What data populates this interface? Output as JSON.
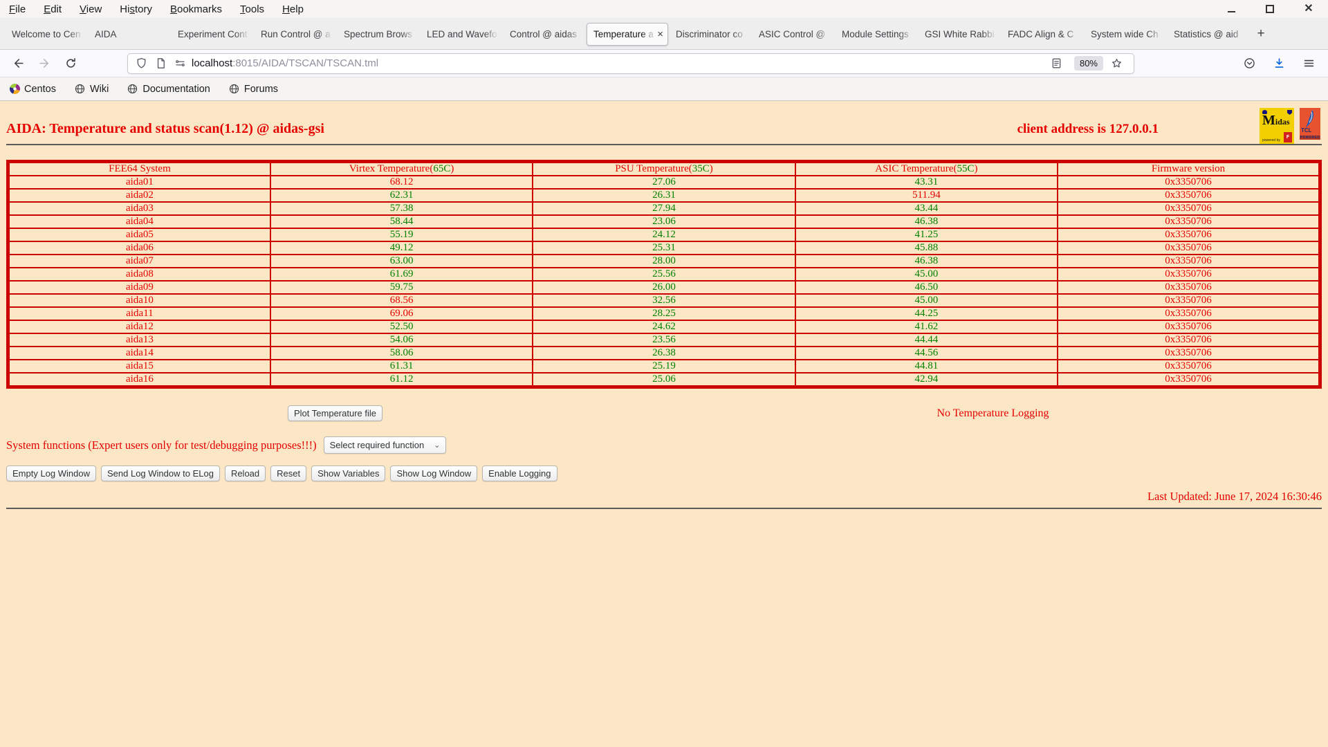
{
  "menubar": {
    "items": [
      {
        "key": "file",
        "pre": "",
        "u": "F",
        "post": "ile"
      },
      {
        "key": "edit",
        "pre": "",
        "u": "E",
        "post": "dit"
      },
      {
        "key": "view",
        "pre": "",
        "u": "V",
        "post": "iew"
      },
      {
        "key": "history",
        "pre": "Hi",
        "u": "s",
        "post": "tory"
      },
      {
        "key": "bookmarks",
        "pre": "",
        "u": "B",
        "post": "ookmarks"
      },
      {
        "key": "tools",
        "pre": "",
        "u": "T",
        "post": "ools"
      },
      {
        "key": "help",
        "pre": "",
        "u": "H",
        "post": "elp"
      }
    ]
  },
  "tabbar": {
    "tabs": [
      {
        "label": "Welcome to Cen",
        "active": false
      },
      {
        "label": "AIDA",
        "active": false
      },
      {
        "label": "Experiment Cont",
        "active": false
      },
      {
        "label": "Run Control @ a",
        "active": false
      },
      {
        "label": "Spectrum Brows",
        "active": false
      },
      {
        "label": "LED and Wavefo",
        "active": false
      },
      {
        "label": "Control @ aidas",
        "active": false
      },
      {
        "label": "Temperature a",
        "active": true
      },
      {
        "label": "Discriminator co",
        "active": false
      },
      {
        "label": "ASIC Control @",
        "active": false
      },
      {
        "label": "Module Settings",
        "active": false
      },
      {
        "label": "GSI White Rabbi",
        "active": false
      },
      {
        "label": "FADC Align & C",
        "active": false
      },
      {
        "label": "System wide Ch",
        "active": false
      },
      {
        "label": "Statistics @ aid",
        "active": false
      }
    ],
    "close_glyph": "×",
    "new_tab_glyph": "+"
  },
  "navbar": {
    "url": {
      "host": "localhost",
      "rest": ":8015/AIDA/TSCAN/TSCAN.tml"
    },
    "zoom": "80%"
  },
  "bookmarks": [
    {
      "label": "Centos",
      "icon": "centos"
    },
    {
      "label": "Wiki",
      "icon": "globe"
    },
    {
      "label": "Documentation",
      "icon": "globe"
    },
    {
      "label": "Forums",
      "icon": "globe"
    }
  ],
  "page": {
    "title": "AIDA: Temperature and status scan(1.12) @ aidas-gsi",
    "client_address": "client address is 127.0.0.1",
    "logos": {
      "midas_m": "M",
      "midas_rest": "idas",
      "midas_sub": "powered by",
      "midas_box": "F",
      "tcl_text": "TCL",
      "tcl_sub": "POWERED"
    },
    "table": {
      "headers": [
        {
          "pre": "FEE64 System",
          "limit": "",
          "post": ""
        },
        {
          "pre": "Virtex Temperature(",
          "limit": "65C",
          "post": ")"
        },
        {
          "pre": "PSU Temperature(",
          "limit": "35C",
          "post": ")"
        },
        {
          "pre": "ASIC Temperature(",
          "limit": "55C",
          "post": ")"
        },
        {
          "pre": "Firmware version",
          "limit": "",
          "post": ""
        }
      ],
      "rows": [
        {
          "system": "aida01",
          "virtex": "68.12",
          "virtex_alarm": true,
          "psu": "27.06",
          "psu_alarm": false,
          "asic": "43.31",
          "asic_alarm": false,
          "firmware": "0x3350706"
        },
        {
          "system": "aida02",
          "virtex": "62.31",
          "virtex_alarm": false,
          "psu": "26.31",
          "psu_alarm": false,
          "asic": "511.94",
          "asic_alarm": true,
          "firmware": "0x3350706"
        },
        {
          "system": "aida03",
          "virtex": "57.38",
          "virtex_alarm": false,
          "psu": "27.94",
          "psu_alarm": false,
          "asic": "43.44",
          "asic_alarm": false,
          "firmware": "0x3350706"
        },
        {
          "system": "aida04",
          "virtex": "58.44",
          "virtex_alarm": false,
          "psu": "23.06",
          "psu_alarm": false,
          "asic": "46.38",
          "asic_alarm": false,
          "firmware": "0x3350706"
        },
        {
          "system": "aida05",
          "virtex": "55.19",
          "virtex_alarm": false,
          "psu": "24.12",
          "psu_alarm": false,
          "asic": "41.25",
          "asic_alarm": false,
          "firmware": "0x3350706"
        },
        {
          "system": "aida06",
          "virtex": "49.12",
          "virtex_alarm": false,
          "psu": "25.31",
          "psu_alarm": false,
          "asic": "45.88",
          "asic_alarm": false,
          "firmware": "0x3350706"
        },
        {
          "system": "aida07",
          "virtex": "63.00",
          "virtex_alarm": false,
          "psu": "28.00",
          "psu_alarm": false,
          "asic": "46.38",
          "asic_alarm": false,
          "firmware": "0x3350706"
        },
        {
          "system": "aida08",
          "virtex": "61.69",
          "virtex_alarm": false,
          "psu": "25.56",
          "psu_alarm": false,
          "asic": "45.00",
          "asic_alarm": false,
          "firmware": "0x3350706"
        },
        {
          "system": "aida09",
          "virtex": "59.75",
          "virtex_alarm": false,
          "psu": "26.00",
          "psu_alarm": false,
          "asic": "46.50",
          "asic_alarm": false,
          "firmware": "0x3350706"
        },
        {
          "system": "aida10",
          "virtex": "68.56",
          "virtex_alarm": true,
          "psu": "32.56",
          "psu_alarm": false,
          "asic": "45.00",
          "asic_alarm": false,
          "firmware": "0x3350706"
        },
        {
          "system": "aida11",
          "virtex": "69.06",
          "virtex_alarm": true,
          "psu": "28.25",
          "psu_alarm": false,
          "asic": "44.25",
          "asic_alarm": false,
          "firmware": "0x3350706"
        },
        {
          "system": "aida12",
          "virtex": "52.50",
          "virtex_alarm": false,
          "psu": "24.62",
          "psu_alarm": false,
          "asic": "41.62",
          "asic_alarm": false,
          "firmware": "0x3350706"
        },
        {
          "system": "aida13",
          "virtex": "54.06",
          "virtex_alarm": false,
          "psu": "23.56",
          "psu_alarm": false,
          "asic": "44.44",
          "asic_alarm": false,
          "firmware": "0x3350706"
        },
        {
          "system": "aida14",
          "virtex": "58.06",
          "virtex_alarm": false,
          "psu": "26.38",
          "psu_alarm": false,
          "asic": "44.56",
          "asic_alarm": false,
          "firmware": "0x3350706"
        },
        {
          "system": "aida15",
          "virtex": "61.31",
          "virtex_alarm": false,
          "psu": "25.19",
          "psu_alarm": false,
          "asic": "44.81",
          "asic_alarm": false,
          "firmware": "0x3350706"
        },
        {
          "system": "aida16",
          "virtex": "61.12",
          "virtex_alarm": false,
          "psu": "25.06",
          "psu_alarm": false,
          "asic": "42.94",
          "asic_alarm": false,
          "firmware": "0x3350706"
        }
      ]
    },
    "plot_button": "Plot Temperature file",
    "logging_status": "No Temperature Logging",
    "system_functions_label": "System functions (Expert users only for test/debugging purposes!!!)",
    "function_select": {
      "value": "Select required function",
      "chevron": "⌄"
    },
    "action_buttons": [
      "Empty Log Window",
      "Send Log Window to ELog",
      "Reload",
      "Reset",
      "Show Variables",
      "Show Log Window",
      "Enable Logging"
    ],
    "last_updated": "Last Updated: June 17, 2024 16:30:46"
  },
  "colors": {
    "page_bg": "#fbe7c6",
    "alarm_red": "#e60000",
    "ok_green": "#008000",
    "table_border": "#cc0000",
    "download_accent": "#0061e0"
  }
}
